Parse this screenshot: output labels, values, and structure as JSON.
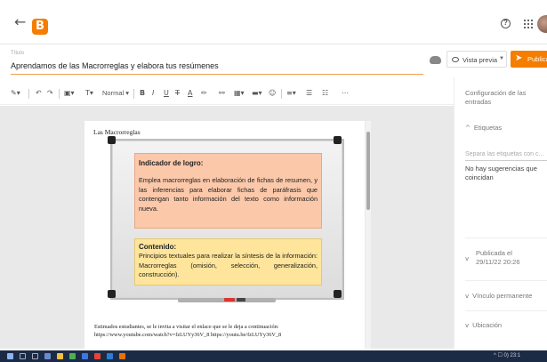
{
  "header": {
    "back_icon": "arrow-left-icon",
    "logo_icon": "blogger-logo-icon",
    "logo_glyph": "B",
    "help_icon": "help-circle-icon",
    "help_glyph": "?",
    "apps_icon": "apps-grid-icon",
    "avatar_icon": "user-avatar-icon"
  },
  "post": {
    "title_label": "Título",
    "title": "Aprendamos de las Macrorreglas y elabora tus resúmenes"
  },
  "actions": {
    "preview_label": "Vista previa",
    "publish_label": "Publicar"
  },
  "toolbar": {
    "style_label": "Normal"
  },
  "document": {
    "heading": "Las Macrorreglas",
    "box1_title": "Indicador de logro:",
    "box1_text": "Emplea macrorreglas en elaboración de fichas de resumen, y las inferencias para elaborar fichas de paráfrasis que contengan tanto información del texto como información nueva.",
    "box2_title": "Contenido:",
    "box2_text": "Principios textuales para realizar la síntesis de la información: Macrorreglas (omisión, selección, generalización, construcción).",
    "footer_line1": "Estimados estudiantes, se le invita a visitar el enlace que se le deja a continuación:",
    "footer_line2": "https://www.youtube.com/watch?v=fzLUYy36V_8 https://youtu.be/fzLUYy36V_8"
  },
  "sidebar": {
    "config_title": "Configuración de las entradas",
    "labels_header": "Etiquetas",
    "labels_placeholder": "Separa las etiquetas con c...",
    "no_suggestions": "No hay sugerencias que coincidan",
    "published_label": "Publicada el",
    "published_date": "29/11/22 20:26",
    "permalink_label": "Vínculo permanente",
    "location_label": "Ubicación"
  },
  "taskbar": {
    "clock": "^ ☐ 0) 23:1"
  }
}
